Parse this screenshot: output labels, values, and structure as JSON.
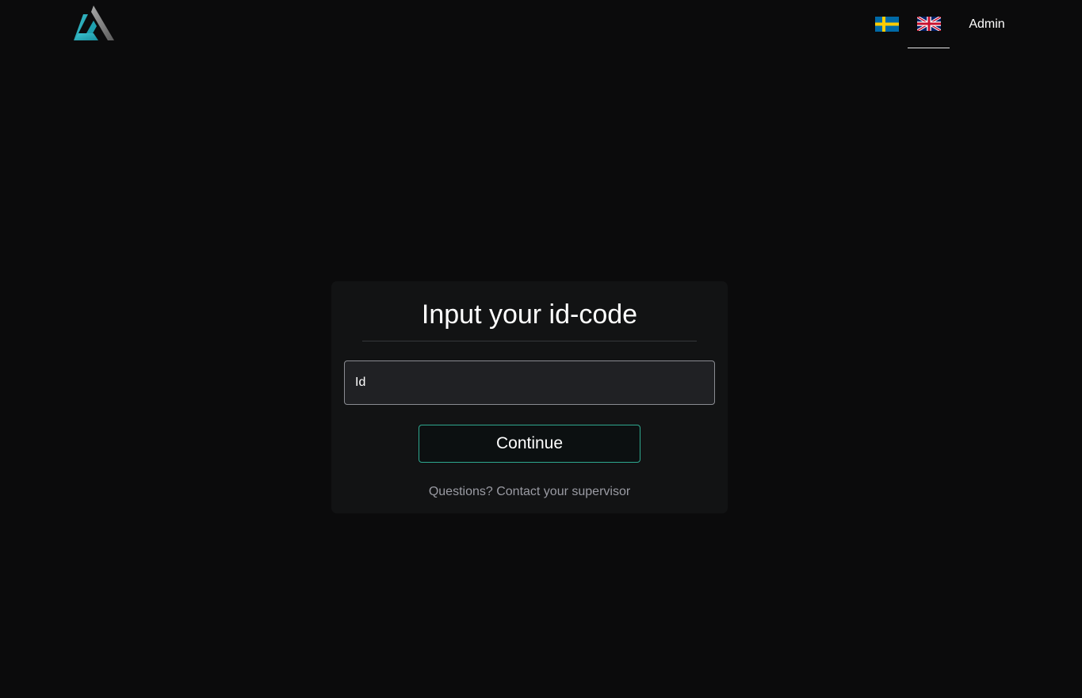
{
  "header": {
    "logo_icon": "triangle-logo",
    "languages": [
      {
        "code": "sv",
        "icon": "swedish-flag-icon",
        "selected": false
      },
      {
        "code": "en",
        "icon": "uk-flag-icon",
        "selected": true
      }
    ],
    "admin_label": "Admin"
  },
  "login": {
    "title": "Input your id-code",
    "id_placeholder": "Id",
    "id_value": "",
    "continue_label": "Continue",
    "help_text": "Questions? Contact your supervisor"
  },
  "colors": {
    "background": "#0b0b0c",
    "card": "#121314",
    "accent": "#2ea88f",
    "logo_teal": "#2bb3c0",
    "logo_grey": "#8c8c8c"
  }
}
